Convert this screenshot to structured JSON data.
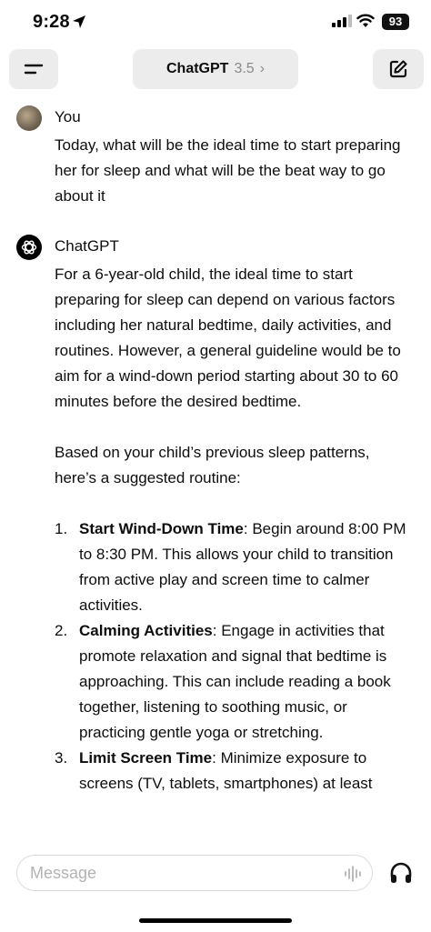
{
  "status": {
    "time": "9:28",
    "battery": "93"
  },
  "nav": {
    "model_name": "ChatGPT",
    "model_version": "3.5",
    "chevron": "›"
  },
  "messages": {
    "user": {
      "sender": "You",
      "text": "Today, what will be the ideal time to start preparing her for sleep and what will be the beat way to go about it"
    },
    "assistant": {
      "sender": "ChatGPT",
      "para1": "For a 6-year-old child, the ideal time to start preparing for sleep can depend on various factors including her natural bedtime, daily activities, and routines. However, a general guideline would be to aim for a wind-down period starting about 30 to 60 minutes before the desired bedtime.",
      "para2": "Based on your child’s previous sleep patterns, here’s a suggested routine:",
      "items": [
        {
          "num": "1.",
          "title": "Start Wind-Down Time",
          "body": ": Begin around 8:00 PM to 8:30 PM. This allows your child to transition from active play and screen time to calmer activities."
        },
        {
          "num": "2.",
          "title": "Calming Activities",
          "body": ": Engage in activities that promote relaxation and signal that bedtime is approaching. This can include reading a book together, listening to soothing music, or practicing gentle yoga or stretching."
        },
        {
          "num": "3.",
          "title": "Limit Screen Time",
          "body": ": Minimize exposure to screens (TV, tablets, smartphones) at least"
        }
      ]
    }
  },
  "composer": {
    "placeholder": "Message"
  },
  "icons": {
    "location": "location-arrow-icon",
    "signal": "cellular-signal-icon",
    "wifi": "wifi-icon",
    "menu": "menu-icon",
    "new_chat": "new-chat-icon",
    "chatgpt_logo": "openai-logo-icon",
    "voice": "voice-waveform-icon",
    "headphones": "headphones-icon"
  }
}
